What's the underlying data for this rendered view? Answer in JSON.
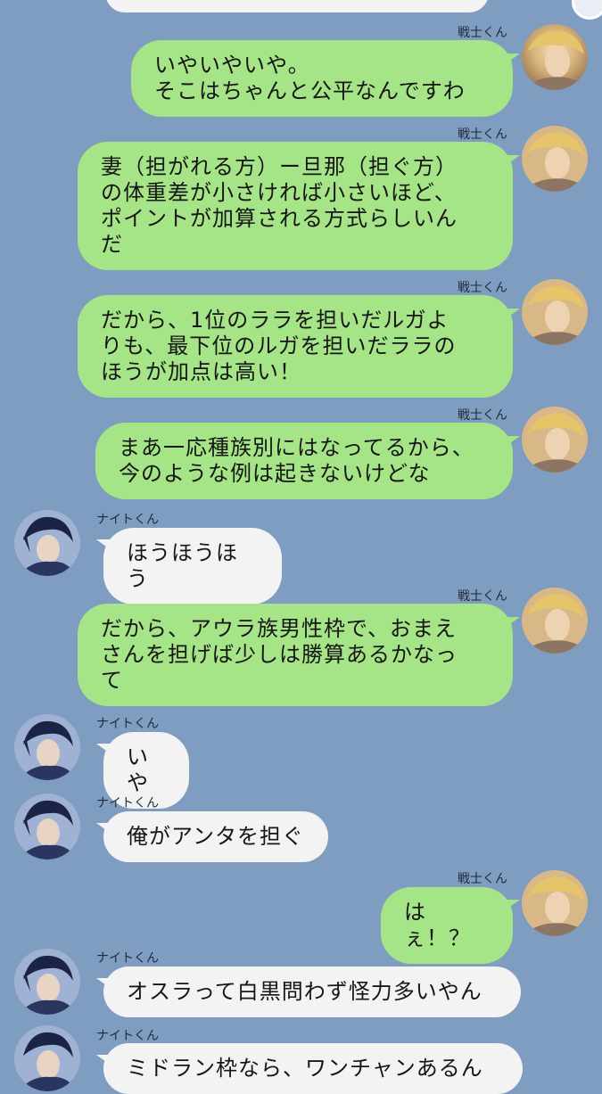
{
  "names": {
    "warrior": "戦士くん",
    "knight": "ナイトくん"
  },
  "messages": [
    {
      "from": "warrior",
      "text": "いやいやいや。\nそこはちゃんと公平なんですわ"
    },
    {
      "from": "warrior",
      "text": "妻（担がれる方）ー旦那（担ぐ方）\nの体重差が小さければ小さいほど、\nポイントが加算される方式らしいん\nだ"
    },
    {
      "from": "warrior",
      "text": "だから、1位のララを担いだルガよ\nりも、最下位のルガを担いだララの\nほうが加点は高い！"
    },
    {
      "from": "warrior",
      "text": "まあ一応種族別にはなってるから、\n今のような例は起きないけどな"
    },
    {
      "from": "knight",
      "text": "ほうほうほう"
    },
    {
      "from": "warrior",
      "text": "だから、アウラ族男性枠で、おまえ\nさんを担げば少しは勝算あるかなっ\nて"
    },
    {
      "from": "knight",
      "text": "いや"
    },
    {
      "from": "knight",
      "text": "俺がアンタを担ぐ"
    },
    {
      "from": "warrior",
      "text": "はぇ！？"
    },
    {
      "from": "knight",
      "text": "オスラって白黒問わず怪力多いやん"
    },
    {
      "from": "knight",
      "text": "ミドラン枠なら、ワンチャンあるん"
    }
  ],
  "colors": {
    "background": "#7f9dc1",
    "outgoing_bubble": "#a5e487",
    "incoming_bubble": "#f3f3f3"
  }
}
